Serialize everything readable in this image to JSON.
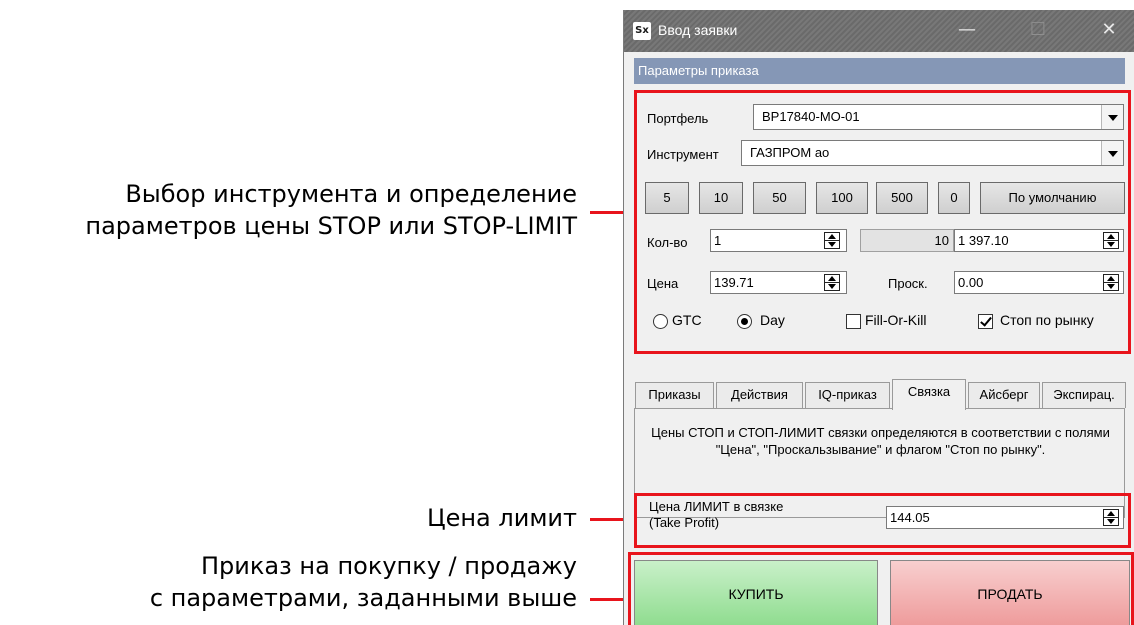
{
  "annotations": {
    "params_line1": "Выбор инструмента и определение",
    "params_line2": "параметров цены STOP или STOP-LIMIT",
    "limit": "Цена лимит",
    "order_line1": "Приказ на покупку / продажу",
    "order_line2": "с параметрами, заданными выше"
  },
  "window": {
    "app_icon": "Sx",
    "title": "Ввод заявки",
    "minimize": "—",
    "maximize": "☐",
    "close": "✕"
  },
  "section_header": "Параметры приказа",
  "portfolio": {
    "label": "Портфель",
    "value": "BP17840-MO-01"
  },
  "instrument": {
    "label": "Инструмент",
    "value": "ГАЗПРОМ ао"
  },
  "quick_buttons": [
    "5",
    "10",
    "50",
    "100",
    "500",
    "0",
    "По умолчанию"
  ],
  "qty": {
    "label": "Кол-во",
    "value": "1",
    "lots": "10",
    "amount": "1 397.10"
  },
  "price": {
    "label": "Цена",
    "value": "139.71",
    "slip_label": "Проск.",
    "slip_value": "0.00"
  },
  "options": {
    "gtc": {
      "label": "GTC",
      "checked": false
    },
    "day": {
      "label": "Day",
      "checked": true
    },
    "fill_or_kill": {
      "label": "Fill-Or-Kill",
      "checked": false
    },
    "stop_market": {
      "label": "Стоп по рынку",
      "checked": true
    }
  },
  "tabs": [
    {
      "label": "Приказы",
      "active": false
    },
    {
      "label": "Действия",
      "active": false
    },
    {
      "label": "IQ-приказ",
      "active": false
    },
    {
      "label": "Связка",
      "active": true
    },
    {
      "label": "Айсберг",
      "active": false
    },
    {
      "label": "Экспирац.",
      "active": false
    }
  ],
  "tab_description": "Цены СТОП и СТОП-ЛИМИТ связки определяются в соответствии с полями \"Цена\", \"Проскальзывание\" и флагом \"Стоп по рынку\".",
  "limit_price": {
    "label_line1": "Цена ЛИМИТ в связке",
    "label_line2": "(Take Profit)",
    "value": "144.05"
  },
  "actions": {
    "buy": "КУПИТЬ",
    "sell": "ПРОДАТЬ"
  },
  "colors": {
    "accent_red": "#e8141c",
    "section_header": "#8597b6",
    "buy": "#a8e6a8",
    "sell": "#f4b4b4"
  }
}
